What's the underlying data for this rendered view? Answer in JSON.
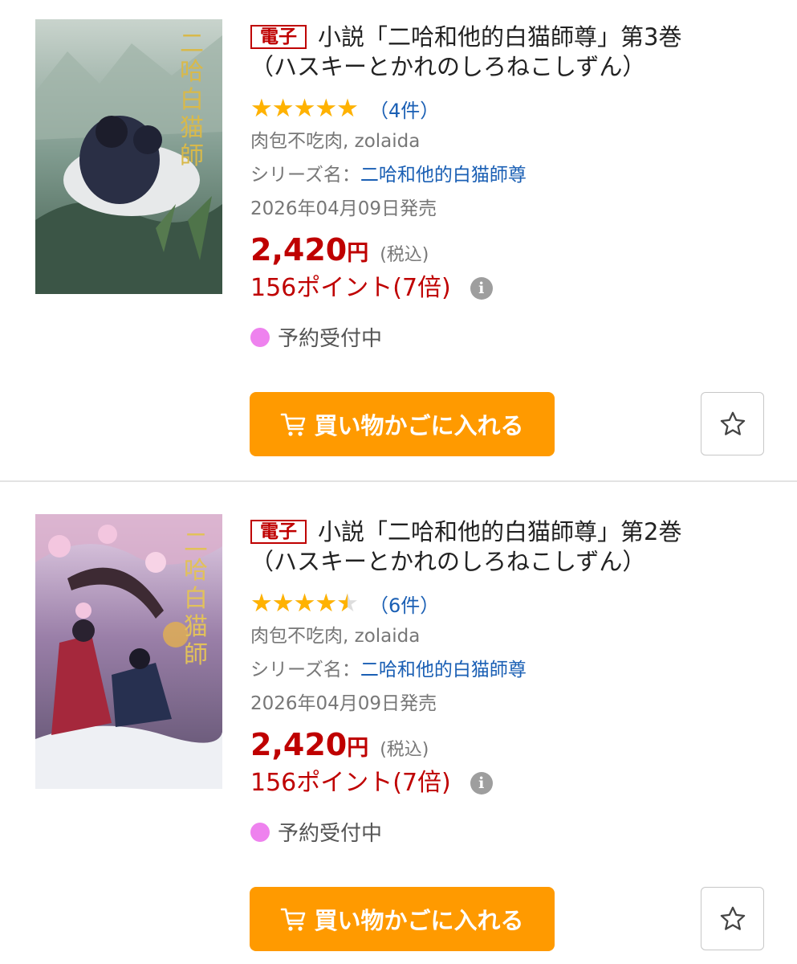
{
  "products": [
    {
      "badge": "電子",
      "title_line1": "小説「二哈和他的白猫師尊」第3巻",
      "title_line2": "（ハスキーとかれのしろねこしずん）",
      "rating": 5.0,
      "stars": "★★★★★",
      "review_count": "（4件）",
      "author": "肉包不吃肉, zolaida",
      "series_label": "シリーズ名：",
      "series_name": "二哈和他的白猫師尊",
      "release": "2026年04月09日発売",
      "price": "2,420",
      "currency": "円",
      "tax": "(税込)",
      "points": "156ポイント(7倍)",
      "info_icon": "i",
      "status": "予約受付中",
      "status_color": "#ee82ee",
      "cart_label": "買い物かごに入れる",
      "icons": {
        "cart": "cart-icon",
        "favorite": "star-outline-icon",
        "info": "info-icon"
      }
    },
    {
      "badge": "電子",
      "title_line1": "小説「二哈和他的白猫師尊」第2巻",
      "title_line2": "（ハスキーとかれのしろねこしずん）",
      "rating": 4.5,
      "stars": "★★★★★",
      "review_count": "（6件）",
      "author": "肉包不吃肉, zolaida",
      "series_label": "シリーズ名：",
      "series_name": "二哈和他的白猫師尊",
      "release": "2026年04月09日発売",
      "price": "2,420",
      "currency": "円",
      "tax": "(税込)",
      "points": "156ポイント(7倍)",
      "info_icon": "i",
      "status": "予約受付中",
      "status_color": "#ee82ee",
      "cart_label": "買い物かごに入れる",
      "icons": {
        "cart": "cart-icon",
        "favorite": "star-outline-icon",
        "info": "info-icon"
      }
    }
  ],
  "colors": {
    "accent_red": "#bf0000",
    "button_orange": "#ff9a00",
    "star_gold": "#ffb200",
    "link_blue": "#1a5fb4"
  }
}
